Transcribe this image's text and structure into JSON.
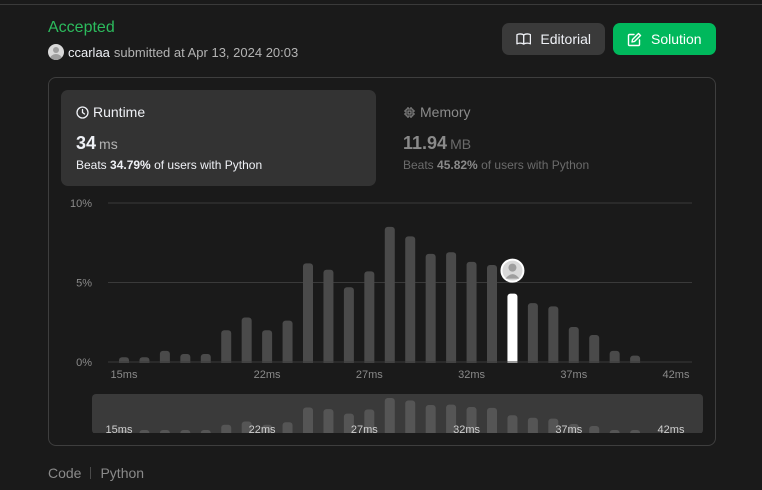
{
  "submission": {
    "status": "Accepted",
    "username": "ccarlaa",
    "submitted_text": "submitted at Apr 13, 2024 20:03"
  },
  "buttons": {
    "editorial": "Editorial",
    "solution": "Solution"
  },
  "runtime": {
    "label": "Runtime",
    "value": "34",
    "unit": "ms",
    "beats_prefix": "Beats",
    "beats_value": "34.79%",
    "beats_suffix": "of users with Python"
  },
  "memory": {
    "label": "Memory",
    "value": "11.94",
    "unit": "MB",
    "beats_prefix": "Beats",
    "beats_value": "45.82%",
    "beats_suffix": "of users with Python"
  },
  "footer": {
    "code_label": "Code",
    "language": "Python"
  },
  "colors": {
    "accepted": "#2cbb5d",
    "solution_button": "#00b85c",
    "bar": "#4a4a4a",
    "bar_highlight": "#ffffff"
  },
  "icons": {
    "editorial": "book-open-icon",
    "solution": "edit-icon",
    "runtime": "clock-icon",
    "memory": "chip-icon"
  },
  "chart_data": {
    "type": "bar",
    "x": [
      15,
      16,
      17,
      18,
      19,
      20,
      21,
      22,
      23,
      24,
      25,
      26,
      27,
      28,
      29,
      30,
      31,
      32,
      33,
      34,
      35,
      36,
      37,
      38,
      39,
      40,
      41,
      42
    ],
    "values": [
      0.3,
      0.3,
      0.7,
      0.5,
      0.5,
      2.0,
      2.8,
      2.0,
      2.6,
      6.2,
      5.8,
      4.7,
      5.7,
      8.5,
      7.9,
      6.8,
      6.9,
      6.3,
      6.1,
      4.3,
      3.7,
      3.5,
      2.2,
      1.7,
      0.7,
      0.4,
      0,
      0
    ],
    "highlight_x": 34,
    "yticks": [
      "0%",
      "5%",
      "10%"
    ],
    "ytick_values": [
      0,
      5,
      10
    ],
    "ylim": [
      0,
      10
    ],
    "xtick_labels": [
      "15ms",
      "22ms",
      "27ms",
      "32ms",
      "37ms",
      "42ms"
    ],
    "xtick_values": [
      15,
      22,
      27,
      32,
      37,
      42
    ],
    "xlim": [
      15,
      42
    ],
    "grid": true
  }
}
